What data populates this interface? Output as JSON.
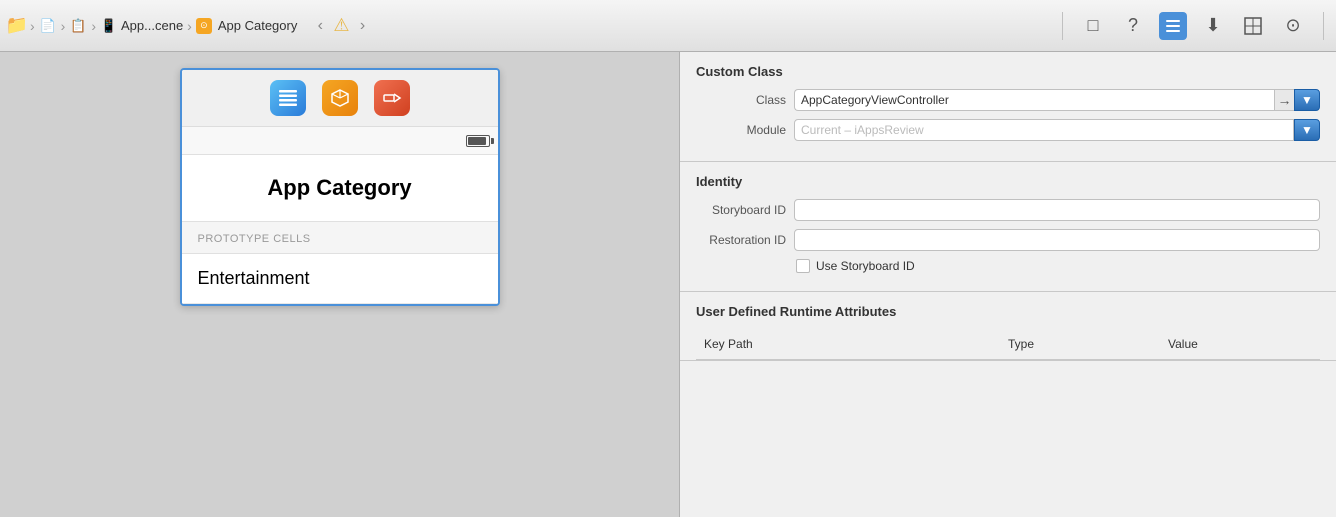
{
  "toolbar": {
    "breadcrumb": [
      {
        "label": "folder",
        "icon": "folder"
      },
      {
        "label": "file",
        "icon": "file"
      },
      {
        "label": "file2",
        "icon": "file"
      },
      {
        "label": "App...cene",
        "icon": "scene"
      },
      {
        "label": "App Category",
        "icon": "category"
      }
    ],
    "back_label": "‹",
    "forward_label": "›",
    "warning_label": "⚠",
    "icons": [
      {
        "name": "file-icon-btn",
        "label": "□",
        "active": false
      },
      {
        "name": "help-icon-btn",
        "label": "?",
        "active": false
      },
      {
        "name": "inspector-icon-btn",
        "label": "≡",
        "active": true
      },
      {
        "name": "library-icon-btn",
        "label": "↓",
        "active": false
      },
      {
        "name": "ruler-icon-btn",
        "label": "𝍸",
        "active": false
      },
      {
        "name": "navigate-icon-btn",
        "label": "→",
        "active": false
      }
    ]
  },
  "canvas": {
    "view_controller": {
      "title": "App Category",
      "icons": [
        {
          "name": "tableview-icon",
          "color": "blue",
          "glyph": "≡"
        },
        {
          "name": "3d-icon",
          "color": "orange",
          "glyph": "◈"
        },
        {
          "name": "exit-icon",
          "color": "red-orange",
          "glyph": "⊣"
        }
      ],
      "prototype_label": "PROTOTYPE CELLS",
      "cell_text": "Entertainment"
    }
  },
  "inspector": {
    "custom_class": {
      "title": "Custom Class",
      "class_label": "Class",
      "class_value": "AppCategoryViewController",
      "class_arrow": "→",
      "class_dropdown": "▼",
      "module_label": "Module",
      "module_placeholder": "Current – iAppsReview",
      "module_dropdown": "▼"
    },
    "identity": {
      "title": "Identity",
      "storyboard_id_label": "Storyboard ID",
      "storyboard_id_value": "",
      "restoration_id_label": "Restoration ID",
      "restoration_id_value": "",
      "use_storyboard_label": "Use Storyboard ID"
    },
    "user_defined": {
      "title": "User Defined Runtime Attributes",
      "col_key": "Key Path",
      "col_type": "Type",
      "col_value": "Value"
    }
  }
}
